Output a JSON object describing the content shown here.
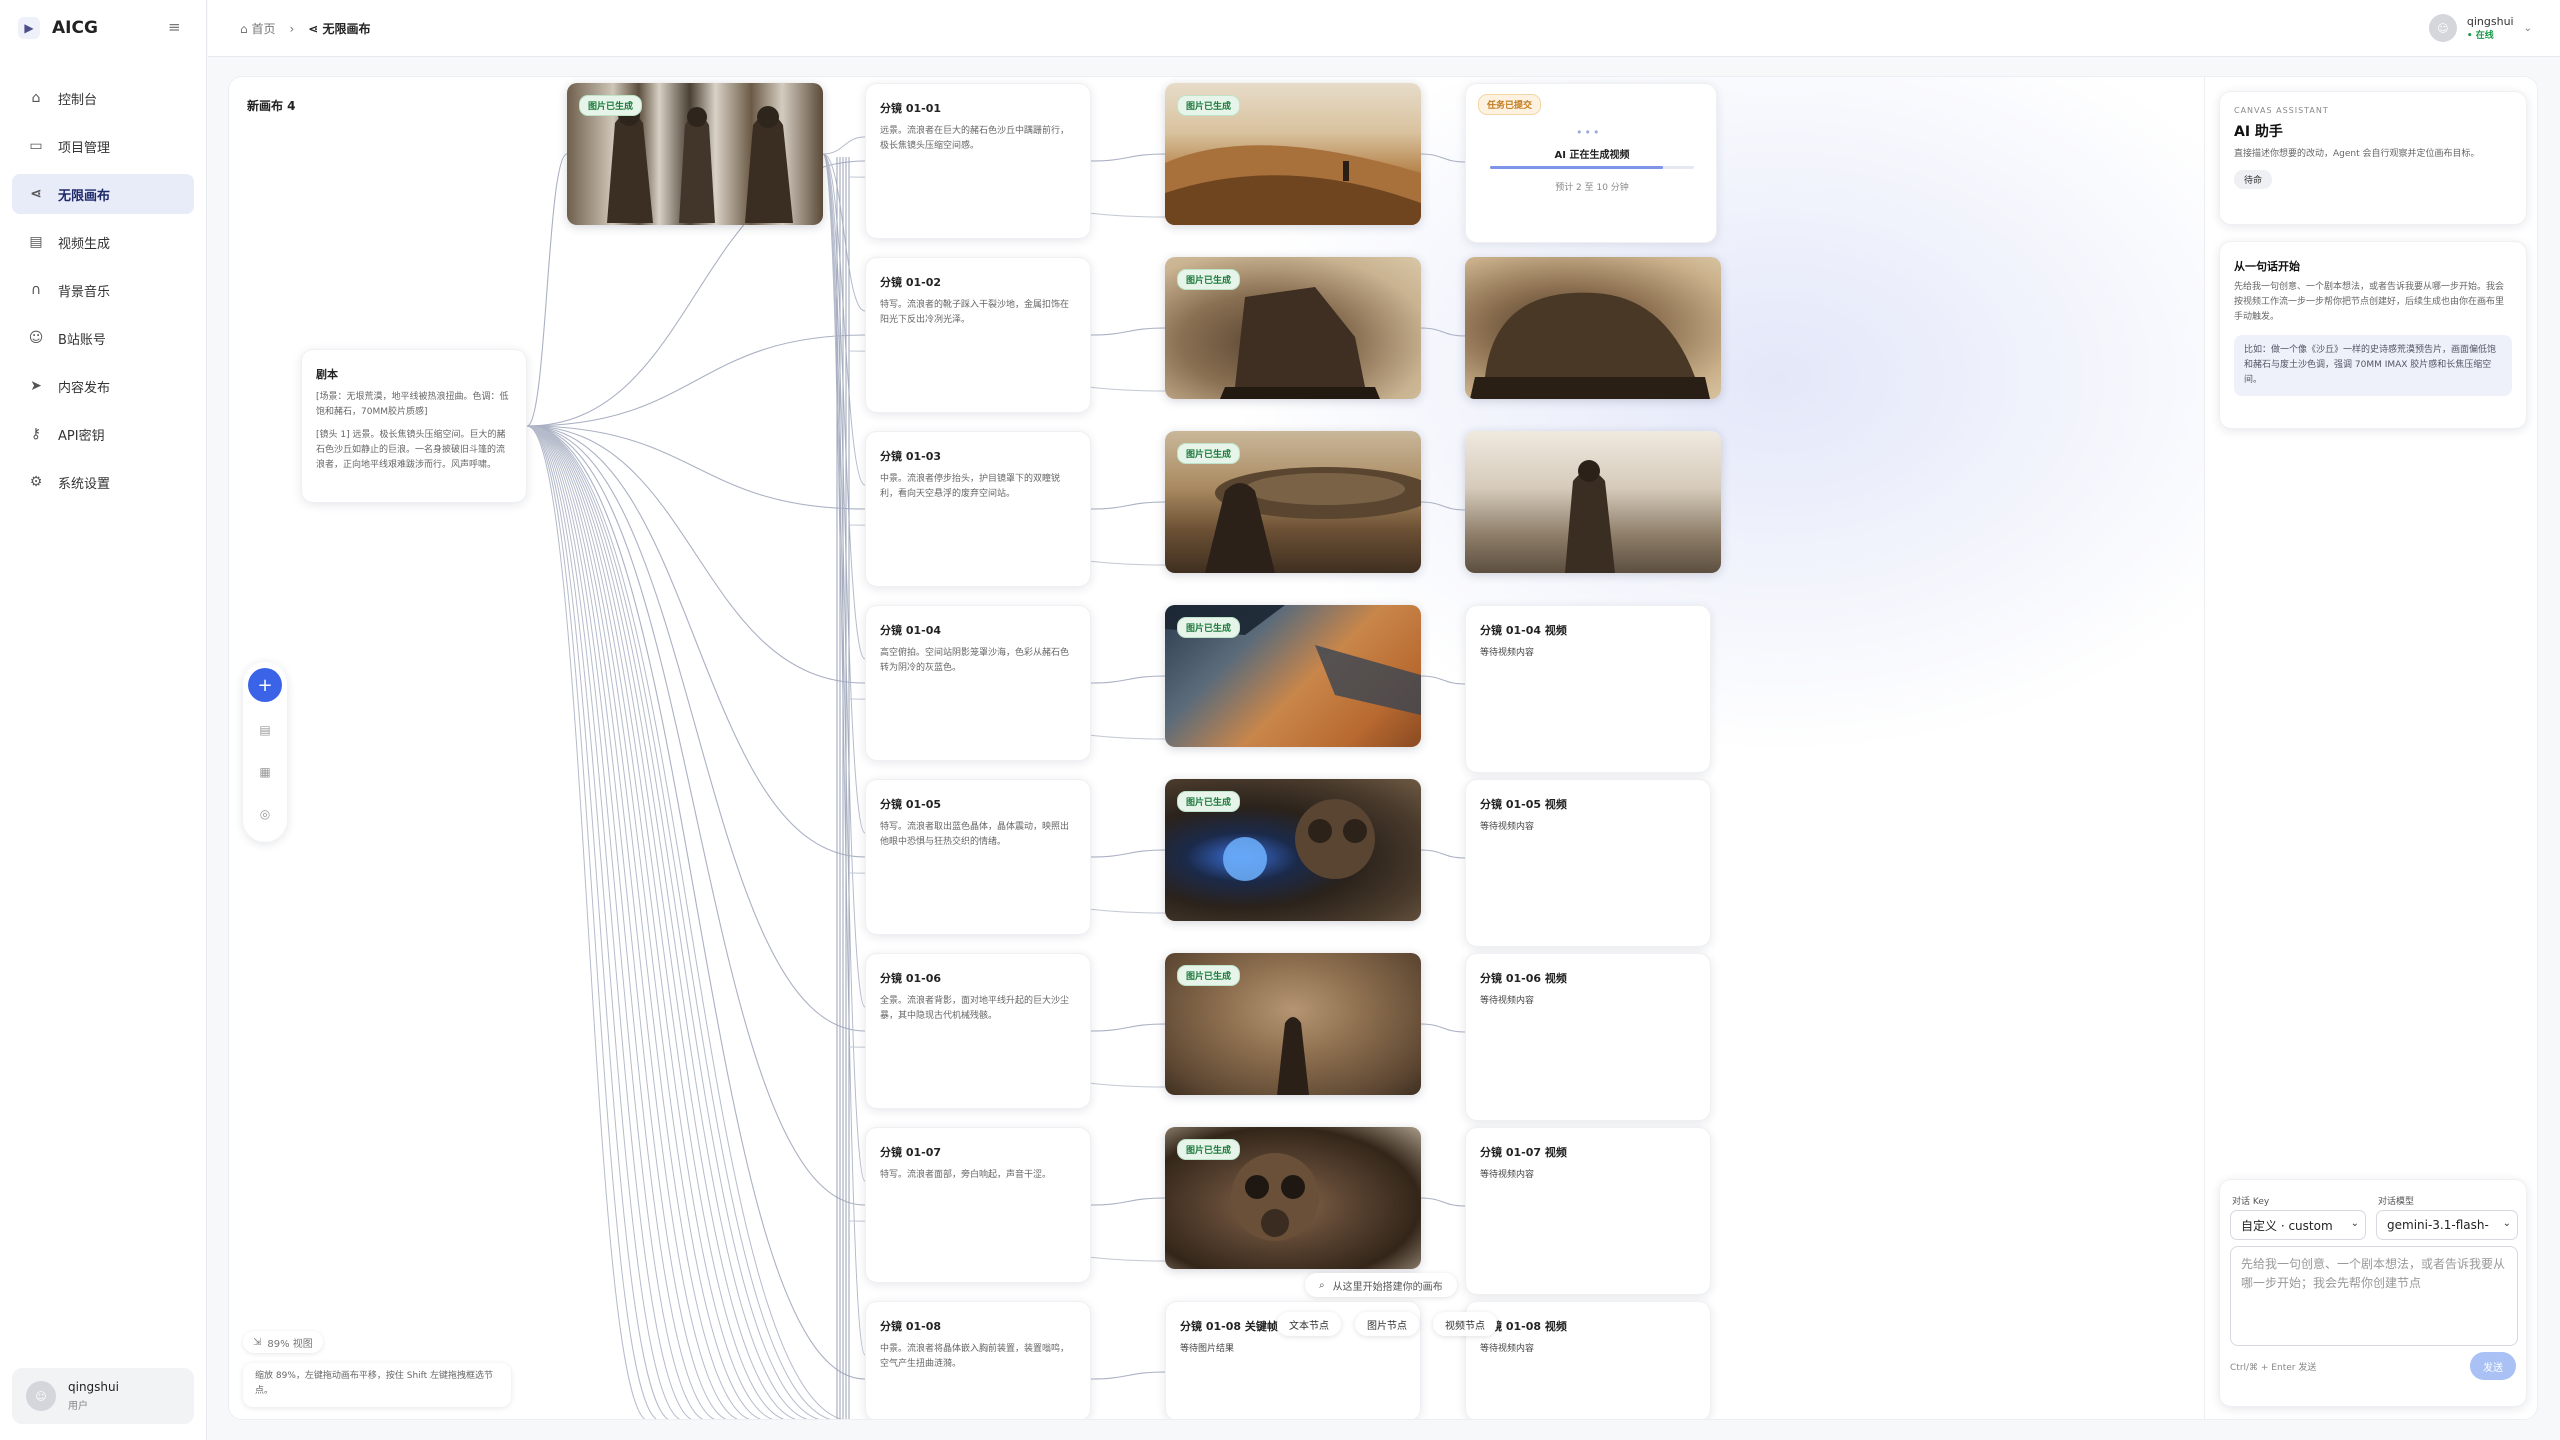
{
  "app": {
    "name": "AICG",
    "collapse_icon": "≡"
  },
  "sidebar": {
    "items": [
      {
        "label": "控制台",
        "icon": "home-icon"
      },
      {
        "label": "项目管理",
        "icon": "folder-icon"
      },
      {
        "label": "无限画布",
        "icon": "share-icon",
        "active": true
      },
      {
        "label": "视频生成",
        "icon": "document-icon"
      },
      {
        "label": "背景音乐",
        "icon": "headphones-icon"
      },
      {
        "label": "B站账号",
        "icon": "user-icon"
      },
      {
        "label": "内容发布",
        "icon": "send-icon"
      },
      {
        "label": "API密钥",
        "icon": "key-icon"
      },
      {
        "label": "系统设置",
        "icon": "gear-icon"
      }
    ],
    "user": {
      "name": "qingshui",
      "role": "用户"
    }
  },
  "topbar": {
    "breadcrumb_home": "首页",
    "breadcrumb_current": "无限画布",
    "user_name": "qingshui",
    "user_status": "• 在线"
  },
  "canvas": {
    "title": "新画布 4",
    "script_node": {
      "title": "剧本",
      "text1": "[场景：无垠荒漠，地平线被热浪扭曲。色调：低饱和赭石，70MM胶片质感]",
      "text2": "[镜头 1] 远景。极长焦镜头压缩空间。巨大的赭石色沙丘如静止的巨浪。一名身披破旧斗篷的流浪者，正向地平线艰难跋涉而行。风声呼啸。"
    },
    "badge_generated": "图片已生成",
    "shots": [
      {
        "title": "分镜 01-01",
        "text": "远景。流浪者在巨大的赭石色沙丘中蹒跚前行，极长焦镜头压缩空间感。"
      },
      {
        "title": "分镜 01-02",
        "text": "特写。流浪者的靴子踩入干裂沙地，金属扣饰在阳光下反出冷冽光泽。"
      },
      {
        "title": "分镜 01-03",
        "text": "中景。流浪者停步抬头，护目镜罩下的双瞳锐利，看向天空悬浮的废弃空间站。"
      },
      {
        "title": "分镜 01-04",
        "text": "高空俯拍。空间站阴影笼罩沙海，色彩从赭石色转为阴冷的灰蓝色。"
      },
      {
        "title": "分镜 01-05",
        "text": "特写。流浪者取出蓝色晶体，晶体震动，映照出他眼中恐惧与狂热交织的情绪。"
      },
      {
        "title": "分镜 01-06",
        "text": "全景。流浪者背影，面对地平线升起的巨大沙尘暴，其中隐现古代机械残骸。"
      },
      {
        "title": "分镜 01-07",
        "text": "特写。流浪者面部，旁白响起，声音干涩。"
      },
      {
        "title": "分镜 01-08",
        "text": "中景。流浪者将晶体嵌入胸前装置，装置嗡鸣，空气产生扭曲涟漪。"
      }
    ],
    "task_node": {
      "badge": "任务已提交",
      "status": "AI 正在生成视频",
      "eta": "预计 2 至 10 分钟",
      "progress": 0.85
    },
    "video_nodes": [
      {
        "title": "分镜 01-04 视频",
        "sub": "等待视频内容"
      },
      {
        "title": "分镜 01-05 视频",
        "sub": "等待视频内容"
      },
      {
        "title": "分镜 01-06 视频",
        "sub": "等待视频内容"
      },
      {
        "title": "分镜 01-07 视频",
        "sub": "等待视频内容"
      },
      {
        "title": "分镜 01-08 视频",
        "sub": "等待视频内容"
      }
    ],
    "keyframe_node": {
      "title": "分镜 01-08 关键帧",
      "sub": "等待图片结果"
    },
    "floating_search": "从这里开始搭建你的画布",
    "float_chips": [
      "文本节点",
      "图片节点",
      "视频节点"
    ],
    "zoom_label": "89% 视图",
    "hint": "缩放 89%，左键拖动画布平移，按住 Shift 左键拖拽框选节点。"
  },
  "assistant": {
    "tag": "CANVAS ASSISTANT",
    "title": "AI 助手",
    "desc": "直接描述你想要的改动，Agent 会自行观察并定位画布目标。",
    "status": "待命",
    "start_title": "从一句话开始",
    "start_desc": "先给我一句创意、一个剧本想法，或者告诉我要从哪一步开始。我会按视频工作流一步一步帮你把节点创建好，后续生成也由你在画布里手动触发。",
    "example": "比如：做一个像《沙丘》一样的史诗感荒漠预告片，画面偏低饱和赭石与废土沙色调，强调 70MM IMAX 胶片感和长焦压缩空间。",
    "key_label": "对话 Key",
    "key_value": "自定义 · custom",
    "model_label": "对话模型",
    "model_value": "gemini-3.1-flash-",
    "placeholder": "先给我一句创意、一个剧本想法，或者告诉我要从哪一步开始；我会先帮你创建节点",
    "send_hint": "Ctrl/⌘ + Enter 发送",
    "send_label": "发送"
  },
  "colors": {
    "accent": "#3b63e8",
    "active_bg": "#e8ebf8",
    "badge_green": "#1e7a3c"
  }
}
